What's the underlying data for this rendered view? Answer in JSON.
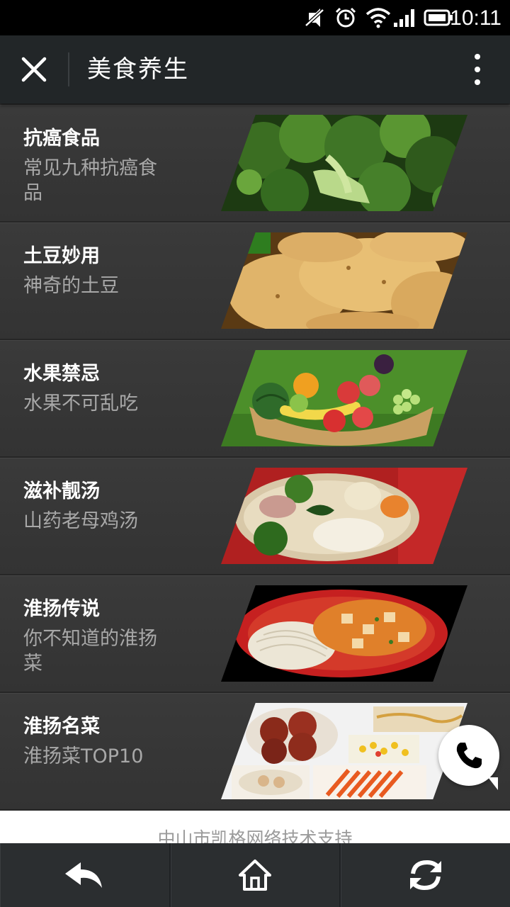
{
  "status_bar": {
    "time": "10:11",
    "icons": [
      "mute-icon",
      "alarm-icon",
      "wifi-icon",
      "signal-icon",
      "battery-icon"
    ]
  },
  "header": {
    "title": "美食养生",
    "close_icon": "close-icon",
    "more_icon": "more-vertical-icon"
  },
  "items": [
    {
      "title": "抗癌食品",
      "subtitle": "常见九种抗癌食品",
      "image": "broccoli"
    },
    {
      "title": "土豆妙用",
      "subtitle": "神奇的土豆",
      "image": "potatoes"
    },
    {
      "title": "水果禁忌",
      "subtitle": "水果不可乱吃",
      "image": "fruit-basket"
    },
    {
      "title": "滋补靓汤",
      "subtitle": "山药老母鸡汤",
      "image": "chicken-soup"
    },
    {
      "title": "淮扬传说",
      "subtitle": "你不知道的淮扬菜",
      "image": "tofu-noodles"
    },
    {
      "title": "淮扬名菜",
      "subtitle": "淮扬菜TOP10",
      "image": "dishes-collage"
    }
  ],
  "footer": {
    "support_text": "中山市凯格网络技术支持"
  },
  "call_button": {
    "icon": "phone-icon"
  },
  "toolbar": {
    "buttons": [
      "back-icon",
      "home-icon",
      "refresh-icon"
    ]
  },
  "colors": {
    "navbar": "#222628",
    "row_bg": "#363636",
    "title": "#ffffff",
    "subtitle": "#a8a8a8"
  }
}
